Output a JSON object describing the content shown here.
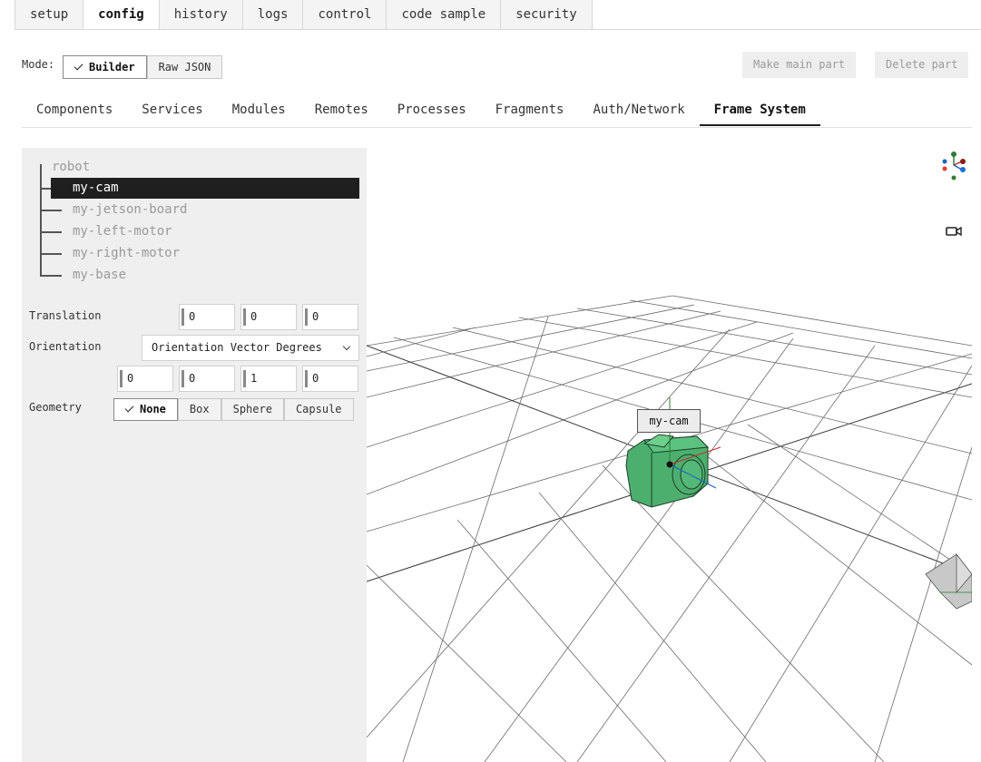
{
  "top_tabs": [
    {
      "label": "setup"
    },
    {
      "label": "config"
    },
    {
      "label": "history"
    },
    {
      "label": "logs"
    },
    {
      "label": "control"
    },
    {
      "label": "code sample"
    },
    {
      "label": "security"
    }
  ],
  "active_top_tab": "config",
  "mode": {
    "label": "Mode:",
    "builder": "Builder",
    "raw_json": "Raw JSON",
    "selected": "Builder"
  },
  "actions": {
    "make_main_part": "Make main part",
    "delete_part": "Delete part"
  },
  "sub_tabs": [
    {
      "label": "Components"
    },
    {
      "label": "Services"
    },
    {
      "label": "Modules"
    },
    {
      "label": "Remotes"
    },
    {
      "label": "Processes"
    },
    {
      "label": "Fragments"
    },
    {
      "label": "Auth/Network"
    },
    {
      "label": "Frame System"
    }
  ],
  "active_sub_tab": "Frame System",
  "tree": {
    "root": "robot",
    "items": [
      {
        "label": "my-cam"
      },
      {
        "label": "my-jetson-board"
      },
      {
        "label": "my-left-motor"
      },
      {
        "label": "my-right-motor"
      },
      {
        "label": "my-base"
      }
    ],
    "selected": "my-cam"
  },
  "properties": {
    "translation_label": "Translation",
    "translation": [
      "0",
      "0",
      "0"
    ],
    "orientation_label": "Orientation",
    "orientation_type": "Orientation Vector Degrees",
    "orientation": [
      "0",
      "0",
      "1",
      "0"
    ],
    "geometry_label": "Geometry",
    "geometry_options": [
      "None",
      "Box",
      "Sphere",
      "Capsule"
    ],
    "geometry_selected": "None"
  },
  "scene": {
    "camera_label": "my-cam",
    "camera_color": "#4caf6e"
  },
  "icons": {
    "gizmo": "axis-gizmo-icon",
    "video": "video-camera-icon"
  }
}
